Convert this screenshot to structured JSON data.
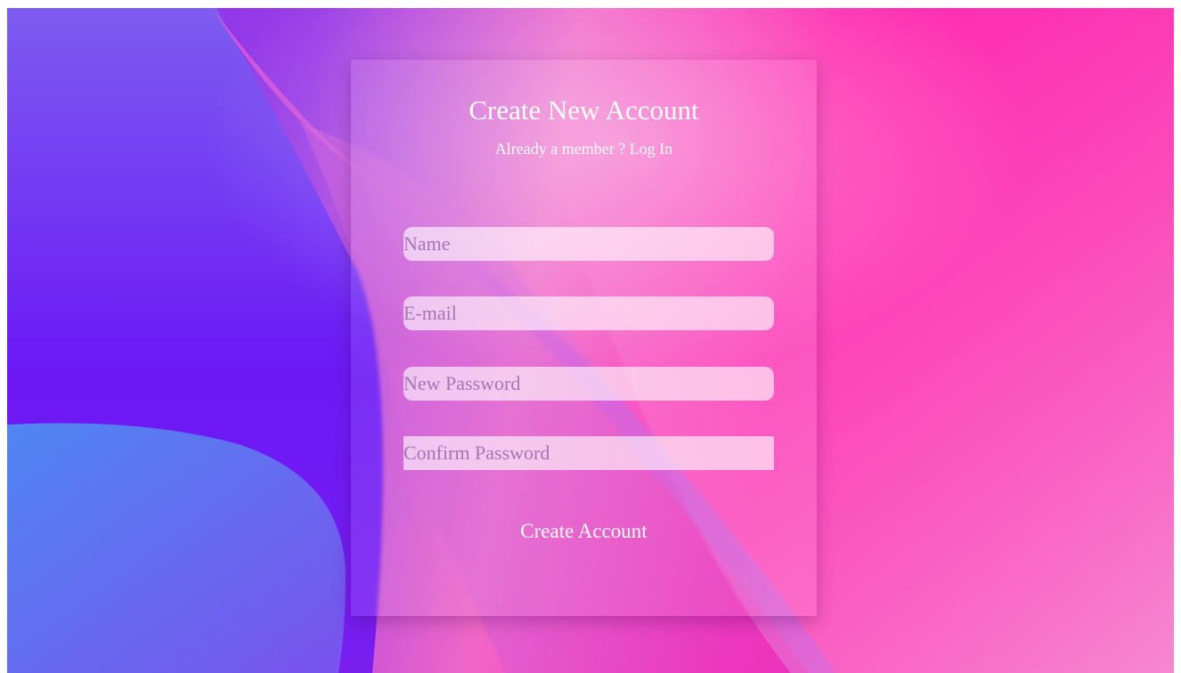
{
  "form": {
    "title": "Create New Account",
    "subtitle_text": "Already a member ? ",
    "login_link": "Log In",
    "fields": {
      "name_placeholder": "Name",
      "email_placeholder": "E-mail",
      "new_password_placeholder": "New Password",
      "confirm_password_placeholder": "Confirm Password"
    },
    "submit_label": "Create Account"
  },
  "theme": {
    "accent_pink": "#ff00a0",
    "accent_purple": "#7a2cf2",
    "accent_blue": "#5b7cf0",
    "text_color": "#ffffff"
  }
}
